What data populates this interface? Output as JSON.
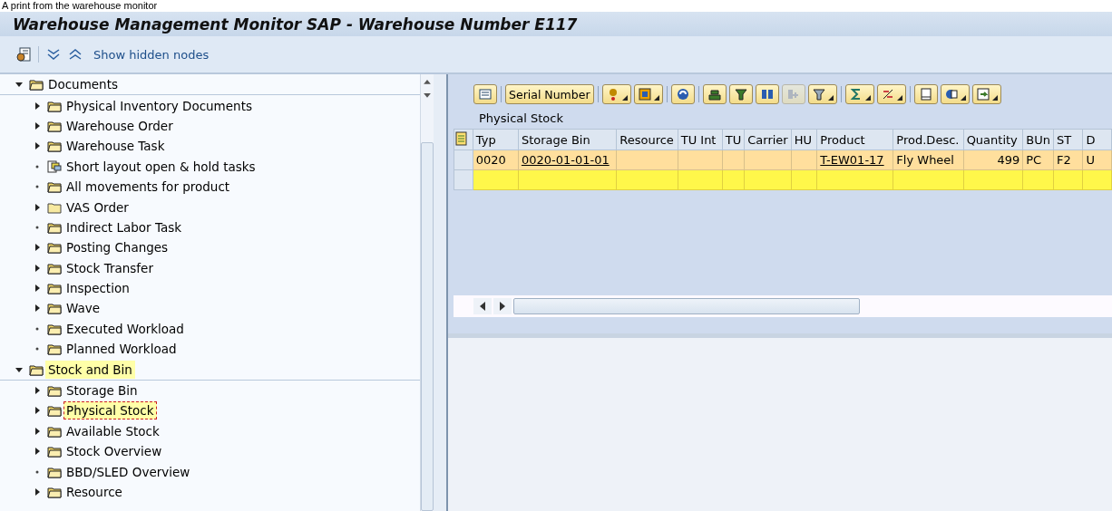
{
  "caption": "A print from the warehouse monitor",
  "window": {
    "title": "Warehouse Management Monitor SAP - Warehouse Number E117"
  },
  "toolbar": {
    "show_hidden_nodes": "Show hidden nodes"
  },
  "tree": [
    {
      "label": "Documents",
      "kind": "folder",
      "expanded": true,
      "highlighted": false,
      "selected": false,
      "children": [
        {
          "label": "Physical Inventory Documents",
          "kind": "folder",
          "expanded": false,
          "selected": false
        },
        {
          "label": "Warehouse Order",
          "kind": "folder",
          "expanded": false,
          "selected": false
        },
        {
          "label": "Warehouse Task",
          "kind": "folder",
          "expanded": false,
          "selected": false
        },
        {
          "label": "Short layout open & hold tasks",
          "kind": "layout",
          "selected": false
        },
        {
          "label": "All movements for product",
          "kind": "folder",
          "selected": false
        },
        {
          "label": "VAS Order",
          "kind": "plain",
          "expanded": false,
          "selected": false
        },
        {
          "label": "Indirect Labor Task",
          "kind": "folder",
          "selected": false
        },
        {
          "label": "Posting Changes",
          "kind": "folder",
          "expanded": false,
          "selected": false
        },
        {
          "label": "Stock Transfer",
          "kind": "folder",
          "expanded": false,
          "selected": false
        },
        {
          "label": "Inspection",
          "kind": "folder",
          "expanded": false,
          "selected": false
        },
        {
          "label": "Wave",
          "kind": "folder",
          "expanded": false,
          "selected": false
        },
        {
          "label": "Executed Workload",
          "kind": "folder",
          "selected": false
        },
        {
          "label": "Planned Workload",
          "kind": "folder",
          "selected": false
        }
      ]
    },
    {
      "label": "Stock and Bin",
      "kind": "folder",
      "expanded": true,
      "highlighted": true,
      "selected": false,
      "children": [
        {
          "label": "Storage Bin",
          "kind": "folder",
          "expanded": false,
          "selected": false
        },
        {
          "label": "Physical Stock",
          "kind": "folder",
          "expanded": false,
          "selected": true
        },
        {
          "label": "Available Stock",
          "kind": "folder",
          "expanded": false,
          "selected": false
        },
        {
          "label": "Stock Overview",
          "kind": "folder",
          "expanded": false,
          "selected": false
        },
        {
          "label": "BBD/SLED Overview",
          "kind": "folder",
          "selected": false
        },
        {
          "label": "Resource",
          "kind": "folder",
          "expanded": false,
          "selected": false
        }
      ]
    }
  ],
  "grid_toolbar": [
    {
      "kind": "icon",
      "menu": false,
      "disabled": false
    },
    {
      "kind": "text",
      "label": "Serial Number",
      "menu": false,
      "disabled": false
    },
    {
      "kind": "icon",
      "menu": true,
      "disabled": false
    },
    {
      "kind": "icon",
      "menu": true,
      "disabled": false
    },
    {
      "kind": "icon",
      "menu": false,
      "disabled": false
    },
    {
      "kind": "icon",
      "menu": false,
      "disabled": false
    },
    {
      "kind": "icon",
      "menu": false,
      "disabled": false
    },
    {
      "kind": "icon",
      "menu": false,
      "disabled": false
    },
    {
      "kind": "icon",
      "menu": false,
      "disabled": true
    },
    {
      "kind": "icon",
      "menu": true,
      "disabled": false
    },
    {
      "kind": "icon",
      "menu": true,
      "disabled": false
    },
    {
      "kind": "icon",
      "menu": true,
      "disabled": false
    },
    {
      "kind": "icon",
      "menu": false,
      "disabled": false
    },
    {
      "kind": "icon",
      "menu": true,
      "disabled": false
    },
    {
      "kind": "icon",
      "menu": true,
      "disabled": false
    }
  ],
  "grid_title": "Physical Stock",
  "table": {
    "columns": [
      "Typ",
      "Storage Bin",
      "Resource",
      "TU Int",
      "TU",
      "Carrier",
      "HU",
      "Product",
      "Prod.Desc.",
      "Quantity",
      "BUn",
      "ST",
      "D"
    ],
    "rows": [
      {
        "cells": [
          "0020",
          "0020-01-01-01",
          "",
          "",
          "",
          "",
          "",
          "T-EW01-17",
          "Fly Wheel",
          "499",
          "PC",
          "F2",
          "U"
        ],
        "links": [
          false,
          true,
          false,
          false,
          false,
          false,
          false,
          true,
          false,
          false,
          false,
          false,
          false
        ],
        "selected": false
      }
    ]
  }
}
